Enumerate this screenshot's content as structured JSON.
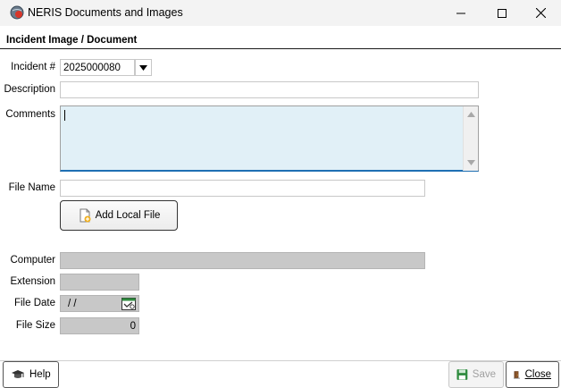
{
  "window": {
    "title": "NERIS Documents and Images",
    "icon": "app-globe-icon"
  },
  "section": {
    "title": "Incident Image / Document"
  },
  "form": {
    "incident_label": "Incident #",
    "incident_value": "2025000080",
    "description_label": "Description",
    "description_value": "",
    "comments_label": "Comments",
    "comments_value": "",
    "file_name_label": "File Name",
    "file_name_value": "",
    "add_local_file_label": "Add Local File",
    "computer_label": "Computer",
    "computer_value": "",
    "extension_label": "Extension",
    "extension_value": "",
    "file_date_label": "File Date",
    "file_date_value": "/ /",
    "file_size_label": "File Size",
    "file_size_value": "0"
  },
  "footer": {
    "help_label": "Help",
    "save_label": "Save",
    "close_label": "Close"
  },
  "colors": {
    "comments_bg": "#e1f0f7",
    "comments_focus_border": "#1e6fb3",
    "disabled_bg": "#c8c8c8",
    "save_green": "#2e8b3e"
  }
}
